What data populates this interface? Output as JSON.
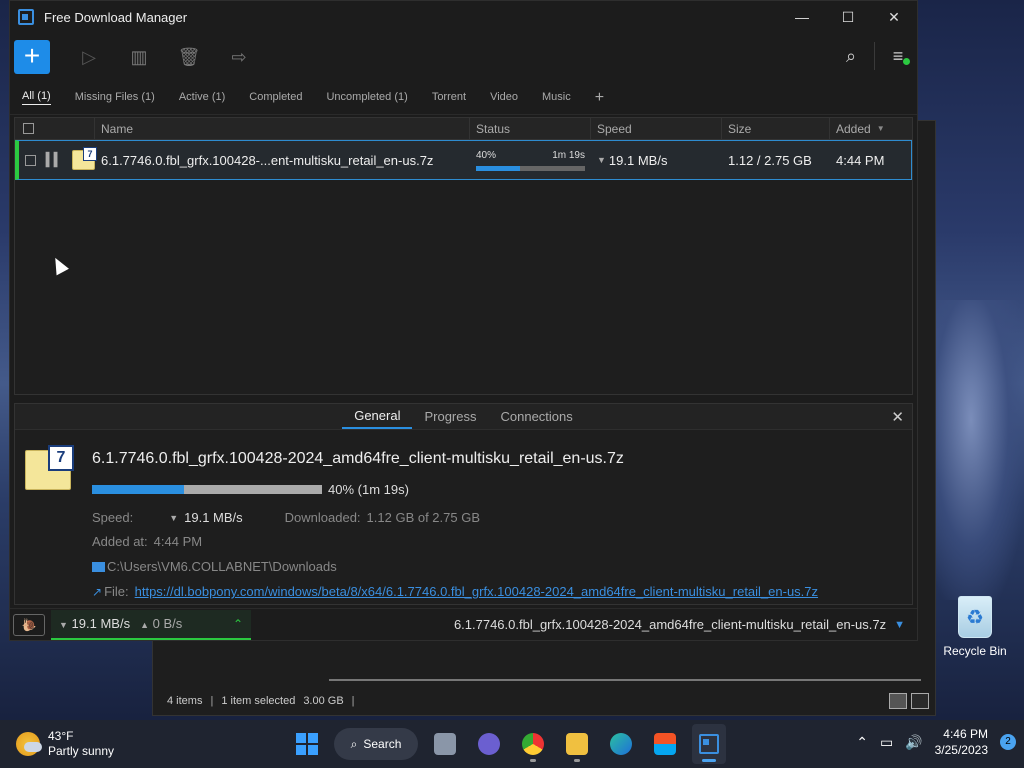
{
  "app": {
    "title": "Free Download Manager",
    "window_controls": {
      "minimize": "—",
      "maximize": "☐",
      "close": "✕"
    }
  },
  "toolbar": {
    "add": "+",
    "icons": [
      "play-icon",
      "pause-all-icon",
      "delete-icon",
      "move-to-folder-icon"
    ],
    "right_icons": [
      "search-icon",
      "menu-icon"
    ]
  },
  "tabs": [
    {
      "label": "All (1)",
      "active": true
    },
    {
      "label": "Missing Files (1)"
    },
    {
      "label": "Active (1)"
    },
    {
      "label": "Completed"
    },
    {
      "label": "Uncompleted (1)"
    },
    {
      "label": "Torrent"
    },
    {
      "label": "Video"
    },
    {
      "label": "Music"
    }
  ],
  "list": {
    "headers": {
      "name": "Name",
      "status": "Status",
      "speed": "Speed",
      "size": "Size",
      "added": "Added"
    },
    "rows": [
      {
        "name": "6.1.7746.0.fbl_grfx.100428-...ent-multisku_retail_en-us.7z",
        "progress_label": "40%",
        "progress": 0.4,
        "time_left": "1m 19s",
        "speed": "19.1 MB/s",
        "size": "1.12 / 2.75 GB",
        "added": "4:44 PM"
      }
    ]
  },
  "details": {
    "tabs": [
      "General",
      "Progress",
      "Connections"
    ],
    "active_tab": "General",
    "file_name": "6.1.7746.0.fbl_grfx.100428-2024_amd64fre_client-multisku_retail_en-us.7z",
    "progress_text": "40% (1m 19s)",
    "progress": 0.4,
    "speed_label": "Speed:",
    "speed_value": "19.1 MB/s",
    "downloaded_label": "Downloaded:",
    "downloaded_value": "1.12 GB of 2.75 GB",
    "added_label": "Added at:",
    "added_value": "4:44 PM",
    "folder": "C:\\Users\\VM6.COLLABNET\\Downloads",
    "file_label": "File:",
    "url": "https://dl.bobpony.com/windows/beta/8/x64/6.1.7746.0.fbl_grfx.100428-2024_amd64fre_client-multisku_retail_en-us.7z"
  },
  "statusbar": {
    "down_speed": "19.1 MB/s",
    "up_speed": "0 B/s",
    "current_file": "6.1.7746.0.fbl_grfx.100428-2024_amd64fre_client-multisku_retail_en-us.7z"
  },
  "explorer": {
    "items": "4 items",
    "selected": "1 item selected",
    "size": "3.00 GB"
  },
  "desktop": {
    "recycle_bin": "Recycle Bin"
  },
  "taskbar": {
    "temp": "43°F",
    "weather": "Partly sunny",
    "search": "Search",
    "time": "4:46 PM",
    "date": "3/25/2023",
    "notifications": "2"
  },
  "colors": {
    "accent": "#1e8ce8",
    "active_green": "#2bc940",
    "link": "#3a8fe0"
  }
}
